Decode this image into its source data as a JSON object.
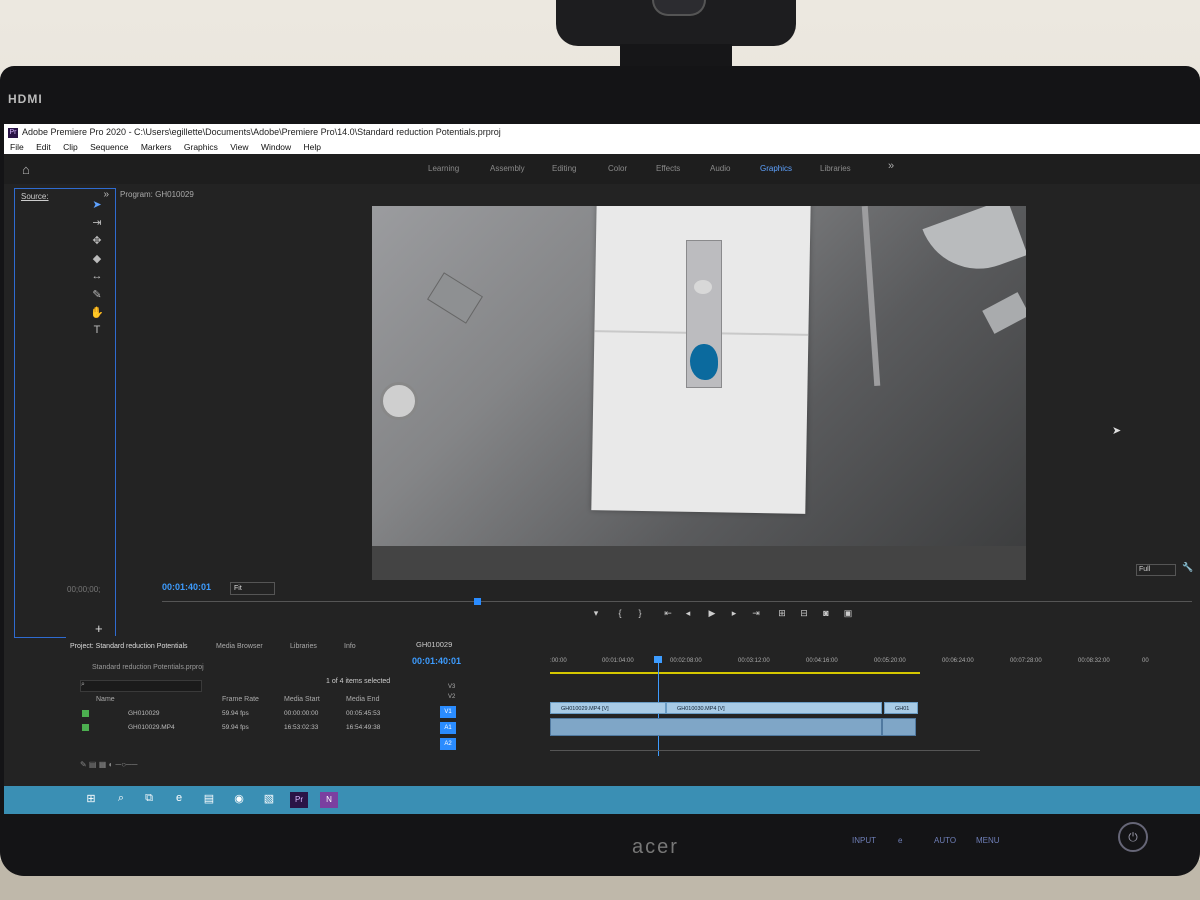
{
  "window": {
    "title": "Adobe Premiere Pro 2020 - C:\\Users\\egillette\\Documents\\Adobe\\Premiere Pro\\14.0\\Standard reduction Potentials.prproj"
  },
  "monitor": {
    "hdmi": "HDMI",
    "brand": "acer",
    "buttons": [
      "INPUT",
      "e",
      "AUTO",
      "MENU"
    ]
  },
  "menu": [
    "File",
    "Edit",
    "Clip",
    "Sequence",
    "Markers",
    "Graphics",
    "View",
    "Window",
    "Help"
  ],
  "workspaces": [
    "Learning",
    "Assembly",
    "Editing",
    "Color",
    "Effects",
    "Audio",
    "Graphics",
    "Libraries"
  ],
  "workspace_active": "Graphics",
  "source": {
    "tab": "Source:",
    "timecode": "00;00;00;"
  },
  "program": {
    "title": "Program: GH010029",
    "timecode": "00:01:40:01",
    "fit": "Fit",
    "resolution": "Full"
  },
  "project": {
    "tabs": [
      "Project: Standard reduction Potentials",
      "Media Browser",
      "Libraries",
      "Info"
    ],
    "name": "Standard reduction Potentials.prproj",
    "count": "1 of 4 items selected",
    "headers": [
      "Name",
      "Frame Rate",
      "Media Start",
      "Media End"
    ],
    "rows": [
      {
        "name": "GH010029",
        "fps": "59.94 fps",
        "start": "00:00:00:00",
        "end": "00:05:45:53"
      },
      {
        "name": "GH010029.MP4",
        "fps": "59.94 fps",
        "start": "16:53:02:33",
        "end": "16:54:49:38"
      }
    ]
  },
  "timeline": {
    "title": "GH010029",
    "timecode": "00:01:40:01",
    "ruler": [
      ":00:00",
      "00:01:04:00",
      "00:02:08:00",
      "00:03:12:00",
      "00:04:16:00",
      "00:05:20:00",
      "00:06:24:00",
      "00:07:28:00",
      "00:08:32:00",
      "00"
    ],
    "tracks": [
      "V3",
      "V2",
      "V1",
      "A1",
      "A2"
    ],
    "clips": [
      "GH010029.MP4 [V]",
      "GH010030.MP4 [V]",
      "GH01"
    ]
  },
  "colors": {
    "accent": "#2a8cff",
    "taskbar": "#3a8fb4"
  }
}
